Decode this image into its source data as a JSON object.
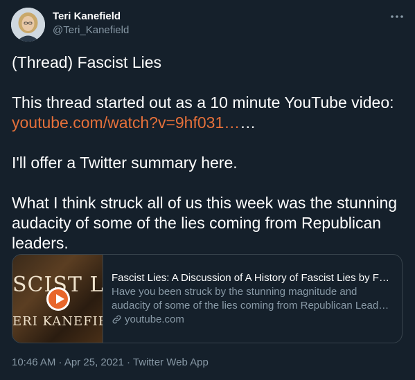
{
  "author": {
    "display_name": "Teri Kanefield",
    "handle": "@Teri_Kanefield"
  },
  "icons": {
    "more": "more-horizontal-icon",
    "link": "link-icon",
    "play": "play-icon"
  },
  "colors": {
    "background": "#15202b",
    "link": "#e5703a",
    "secondary_text": "#8899a6",
    "border": "#38444d"
  },
  "tweet": {
    "line1": "(Thread) Fascist Lies",
    "line2": "This thread started out as a 10 minute YouTube video:",
    "link_text": "youtube.com/watch?v=9hf031…",
    "link_suffix": "…",
    "line3": "I'll offer a Twitter summary here.",
    "line4": "What I think struck all of us this week was the stunning audacity of some of the lies coming from Republican leaders."
  },
  "card": {
    "thumb_line1": "SCIST LI",
    "thumb_line2": "ERI KANEFIEL",
    "title": "Fascist Lies: A Discussion of A History of Fascist Lies by Fede...",
    "desc_line1": "Have you been struck by the stunning magnitude and",
    "desc_line2": "audacity of some of the lies coming from Republican Leader...",
    "domain": "youtube.com"
  },
  "meta": {
    "time": "10:46 AM",
    "sep1": " · ",
    "date": "Apr 25, 2021",
    "sep2": " · ",
    "source": "Twitter Web App"
  }
}
